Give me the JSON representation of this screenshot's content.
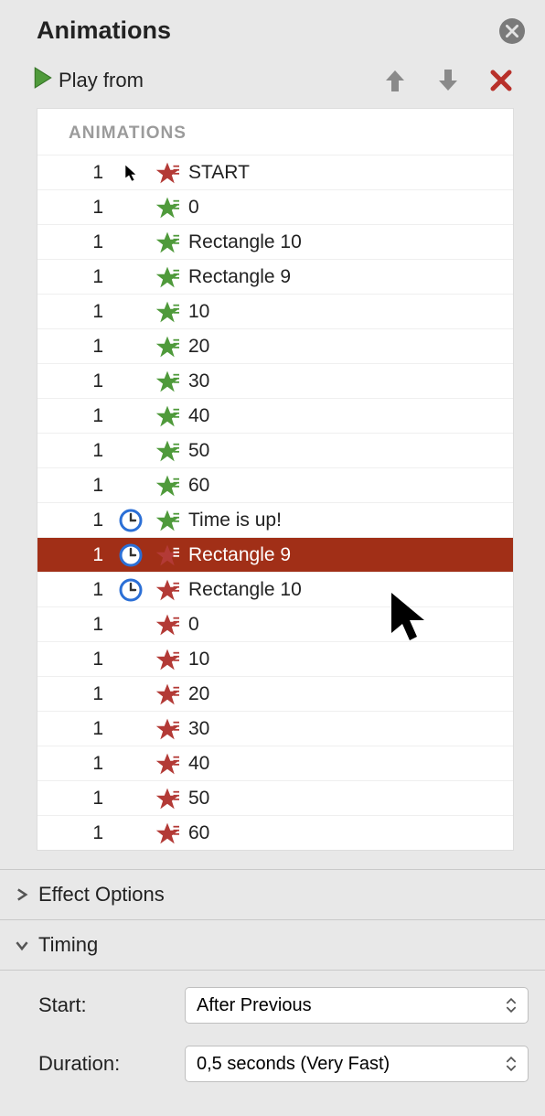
{
  "panel": {
    "title": "Animations"
  },
  "toolbar": {
    "play_label": "Play from"
  },
  "list": {
    "header": "ANIMATIONS",
    "items": [
      {
        "num": "1",
        "trigger": "cursor",
        "star": "red",
        "label": "START"
      },
      {
        "num": "1",
        "trigger": "",
        "star": "green",
        "label": "0"
      },
      {
        "num": "1",
        "trigger": "",
        "star": "green",
        "label": "Rectangle 10"
      },
      {
        "num": "1",
        "trigger": "",
        "star": "green",
        "label": "Rectangle 9"
      },
      {
        "num": "1",
        "trigger": "",
        "star": "green",
        "label": "10"
      },
      {
        "num": "1",
        "trigger": "",
        "star": "green",
        "label": "20"
      },
      {
        "num": "1",
        "trigger": "",
        "star": "green",
        "label": "30"
      },
      {
        "num": "1",
        "trigger": "",
        "star": "green",
        "label": "40"
      },
      {
        "num": "1",
        "trigger": "",
        "star": "green",
        "label": "50"
      },
      {
        "num": "1",
        "trigger": "",
        "star": "green",
        "label": "60"
      },
      {
        "num": "1",
        "trigger": "clock",
        "star": "green",
        "label": "Time is up!"
      },
      {
        "num": "1",
        "trigger": "clock",
        "star": "red",
        "label": "Rectangle 9",
        "selected": true
      },
      {
        "num": "1",
        "trigger": "clock",
        "star": "red",
        "label": "Rectangle 10"
      },
      {
        "num": "1",
        "trigger": "",
        "star": "red",
        "label": "0"
      },
      {
        "num": "1",
        "trigger": "",
        "star": "red",
        "label": "10"
      },
      {
        "num": "1",
        "trigger": "",
        "star": "red",
        "label": "20"
      },
      {
        "num": "1",
        "trigger": "",
        "star": "red",
        "label": "30"
      },
      {
        "num": "1",
        "trigger": "",
        "star": "red",
        "label": "40"
      },
      {
        "num": "1",
        "trigger": "",
        "star": "red",
        "label": "50"
      },
      {
        "num": "1",
        "trigger": "",
        "star": "red",
        "label": "60"
      }
    ]
  },
  "sections": {
    "effect_options": "Effect Options",
    "timing": "Timing"
  },
  "timing": {
    "start_label": "Start:",
    "start_value": "After Previous",
    "duration_label": "Duration:",
    "duration_value": "0,5 seconds (Very Fast)"
  },
  "colors": {
    "green": "#4f9a3b",
    "red": "#b33a36",
    "blue": "#2b6fd6"
  }
}
